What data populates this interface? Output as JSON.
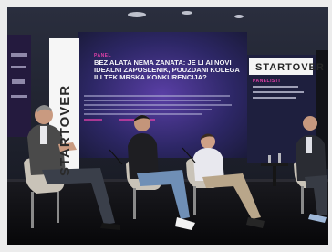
{
  "scene": {
    "brand_vertical": "STARTOVER",
    "brand_screen": "STARTOVER",
    "screen_label": "PANEL",
    "panel_label": "PANELISTI",
    "headline_lines": [
      "BEZ ALATA NEMA ZANATA: JE LI AI NOVI",
      "IDEALNI ZAPOSLENIK, POUZDANI KOLEGA",
      "ILI TEK MRSKA KONKURENCIJA?"
    ],
    "colors": {
      "stage_bg": "#1c1f2c",
      "screen_glow": "#5b3fa8",
      "accent": "#e040a8",
      "floor": "#0f0f12",
      "chair": "#c9c3b8"
    }
  }
}
